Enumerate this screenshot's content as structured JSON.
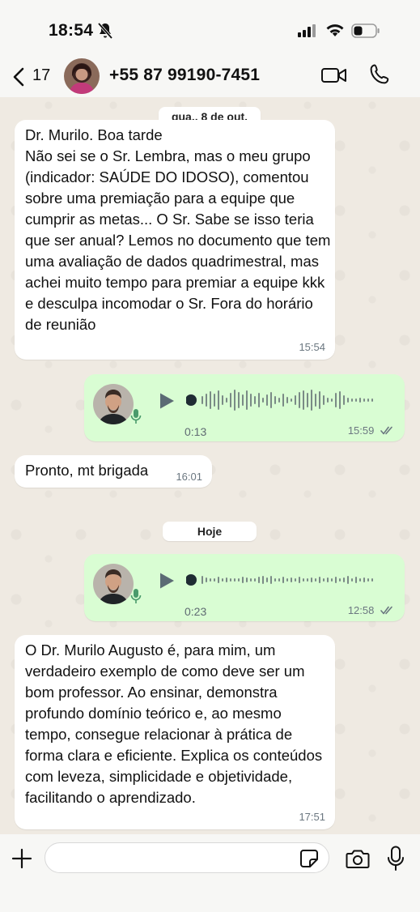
{
  "status_bar": {
    "time": "18:54"
  },
  "header": {
    "back_count": "17",
    "contact_name": "+55 87 99190-7451"
  },
  "dates": {
    "first": "qua., 8 de out.",
    "today": "Hoje"
  },
  "messages": {
    "m1": {
      "text": "Dr. Murilo. Boa tarde\nNão sei se o Sr. Lembra, mas o meu grupo (indicador: SAÚDE DO IDOSO), comentou sobre uma premiação para a equipe que cumprir as metas... O Sr. Sabe se isso teria que ser anual? Lemos no documento que tem uma avaliação de dados quadrimestral, mas achei muito tempo para premiar a equipe kkk e desculpa incomodar o Sr. Fora do horário de reunião",
      "time": "15:54"
    },
    "v1": {
      "duration": "0:13",
      "time": "15:59"
    },
    "m2": {
      "text": "Pronto, mt brigada",
      "time": "16:01"
    },
    "v2": {
      "duration": "0:23",
      "time": "12:58"
    },
    "m3": {
      "text": "O Dr. Murilo Augusto é, para mim, um verdadeiro exemplo de como deve ser um bom professor. Ao ensinar, demonstra profundo domínio teórico e, ao mesmo tempo, consegue relacionar à prática de forma clara e eficiente. Explica os conteúdos com leveza, simplicidade e objetividade, facilitando o aprendizado.",
      "time": "17:51"
    }
  },
  "composer": {
    "placeholder": ""
  },
  "colors": {
    "incoming": "#ffffff",
    "outgoing": "#d9fdd3",
    "chat_background": "#efeae2",
    "bars": "#f7f7f5"
  },
  "icons": [
    "back-chevron-icon",
    "video-call-icon",
    "phone-icon",
    "play-icon",
    "mic-icon",
    "plus-icon",
    "sticker-icon",
    "camera-icon",
    "double-check-icon",
    "bell-off-icon",
    "wifi-icon",
    "signal-icon",
    "battery-icon"
  ]
}
